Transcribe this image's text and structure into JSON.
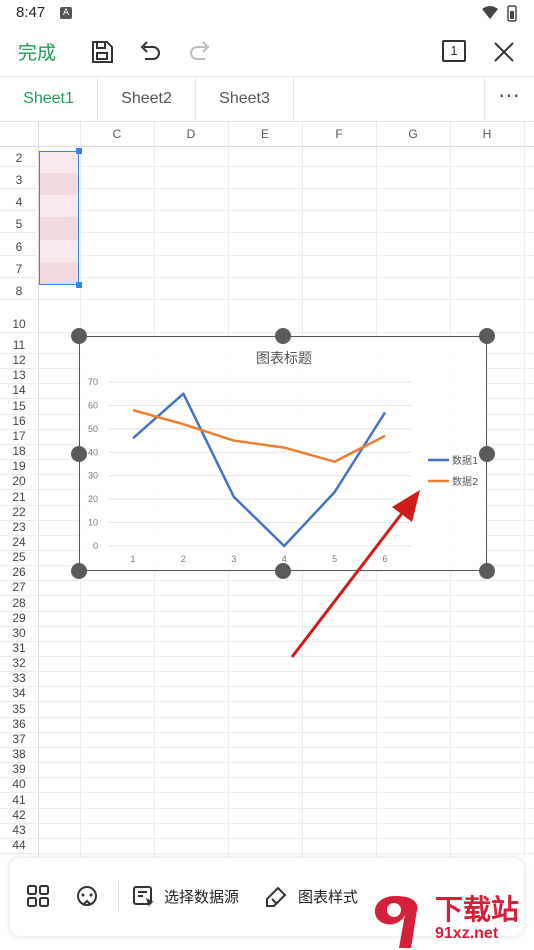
{
  "status": {
    "time": "8:47",
    "notif_badge": "A"
  },
  "toolbar": {
    "done_label": "完成",
    "page_count": "1"
  },
  "tabs": [
    {
      "label": "Sheet1",
      "active": true
    },
    {
      "label": "Sheet2",
      "active": false
    },
    {
      "label": "Sheet3",
      "active": false
    }
  ],
  "more_label": "···",
  "columns": [
    "C",
    "D",
    "E",
    "F",
    "G",
    "H"
  ],
  "rows": [
    "2",
    "3",
    "4",
    "5",
    "6",
    "7",
    "8",
    "10",
    "11",
    "12",
    "13",
    "14",
    "15",
    "16",
    "17",
    "18",
    "19",
    "20",
    "21",
    "22",
    "23",
    "24",
    "25",
    "26",
    "27",
    "28",
    "29",
    "30",
    "31",
    "32",
    "33",
    "34",
    "35",
    "36",
    "37",
    "38",
    "39",
    "40",
    "41",
    "42",
    "43",
    "44"
  ],
  "chart_data": {
    "type": "line",
    "title": "图表标题",
    "categories": [
      "1",
      "2",
      "3",
      "4",
      "5",
      "6"
    ],
    "series": [
      {
        "name": "数据1",
        "color": "#4472c4",
        "values": [
          46,
          65,
          21,
          0,
          23,
          57
        ]
      },
      {
        "name": "数据2",
        "color": "#ed7d31",
        "values": [
          58,
          52,
          45,
          42,
          36,
          47
        ]
      }
    ],
    "ylim": [
      0,
      70
    ],
    "yticks": [
      "0",
      "10",
      "20",
      "30",
      "40",
      "50",
      "60",
      "70"
    ],
    "grid": true,
    "legend": "right"
  },
  "bottom": {
    "select_source_label": "选择数据源",
    "chart_style_label": "图表样式"
  },
  "watermark": {
    "brand": "下载站",
    "url": "91xz.net"
  },
  "colors": {
    "accent": "#1e9e5b",
    "selection": "#3b82e6",
    "arrow": "#d11a1a"
  }
}
